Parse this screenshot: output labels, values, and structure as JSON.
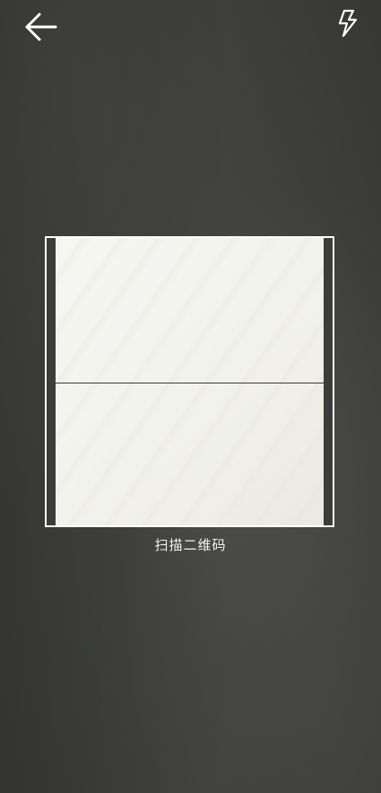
{
  "top_bar": {
    "back_icon": "arrow-left-icon",
    "flash_icon": "flash-icon"
  },
  "scanner": {
    "label": "扫描二维码"
  },
  "colors": {
    "background": "#3e3f3d",
    "frame": "#ffffff",
    "scan_area": "#f3f3ee",
    "label": "#f2f2f2"
  }
}
